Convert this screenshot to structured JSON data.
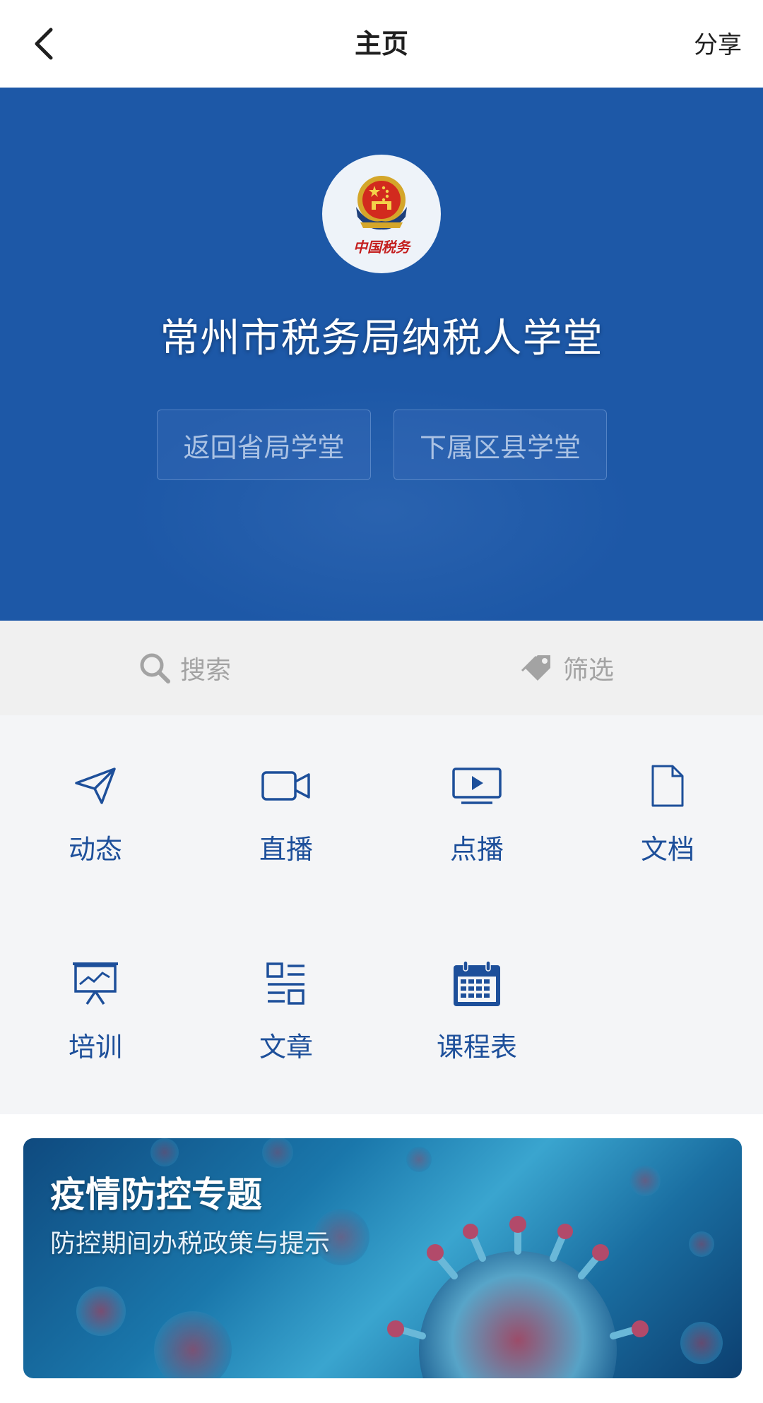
{
  "nav": {
    "title": "主页",
    "share_label": "分享",
    "back_icon": "chevron-left-icon"
  },
  "hero": {
    "background_color": "#1d58a7",
    "logo_text": "中国税务",
    "title": "常州市税务局纳税人学堂",
    "buttons": [
      {
        "label": "返回省局学堂"
      },
      {
        "label": "下属区县学堂"
      }
    ]
  },
  "toolbar": {
    "search_label": "搜索",
    "search_icon": "search-icon",
    "filter_label": "筛选",
    "filter_icon": "tag-icon"
  },
  "features": [
    {
      "label": "动态",
      "icon": "paper-plane-icon"
    },
    {
      "label": "直播",
      "icon": "video-camera-icon"
    },
    {
      "label": "点播",
      "icon": "play-screen-icon"
    },
    {
      "label": "文档",
      "icon": "document-icon"
    },
    {
      "label": "培训",
      "icon": "presentation-board-icon"
    },
    {
      "label": "文章",
      "icon": "article-list-icon"
    },
    {
      "label": "课程表",
      "icon": "calendar-icon"
    }
  ],
  "accent_color": "#1d4f9a",
  "banner": {
    "title": "疫情防控专题",
    "subtitle": "防控期间办税政策与提示"
  }
}
